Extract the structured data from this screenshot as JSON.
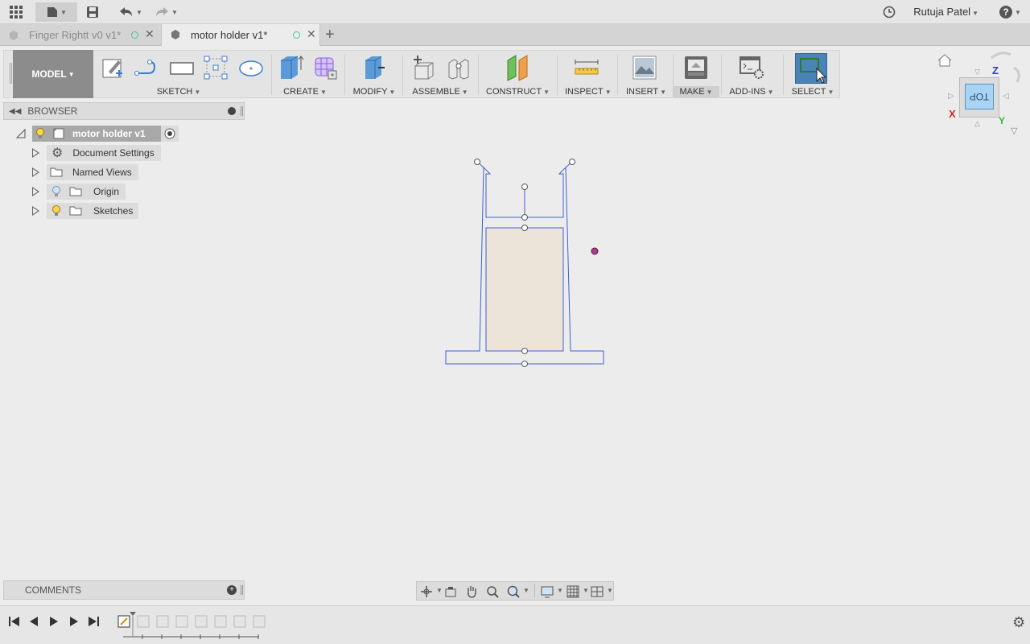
{
  "appbar": {
    "user_name": "Rutuja Patel",
    "icons": [
      "grid-icon",
      "file-icon",
      "save-icon",
      "undo-icon",
      "redo-icon",
      "clock-icon",
      "help-icon"
    ]
  },
  "tabs": [
    {
      "label": "Finger Rightt v0 v1*",
      "active": false
    },
    {
      "label": "motor holder v1*",
      "active": true
    }
  ],
  "toolbar": {
    "workspace": "MODEL",
    "groups": [
      "SKETCH",
      "CREATE",
      "MODIFY",
      "ASSEMBLE",
      "CONSTRUCT",
      "INSPECT",
      "INSERT",
      "MAKE",
      "ADD-INS",
      "SELECT"
    ]
  },
  "browser": {
    "title": "BROWSER",
    "root": "motor holder v1",
    "items": [
      {
        "label": "Document Settings",
        "icon": "gear-icon"
      },
      {
        "label": "Named Views",
        "icon": "folder-icon"
      },
      {
        "label": "Origin",
        "icon": "folder-icon"
      },
      {
        "label": "Sketches",
        "icon": "folder-icon"
      }
    ]
  },
  "comments": {
    "title": "COMMENTS"
  },
  "viewcube": {
    "face": "TOP",
    "axis_x": "X",
    "axis_y": "Y",
    "axis_z": "Z"
  },
  "colors": {
    "sketch_line": "#3f5fd0",
    "profile_fill": "#ece4d8",
    "viewcube_face": "#a9d5f5",
    "accent_select": "#4a84b7"
  }
}
